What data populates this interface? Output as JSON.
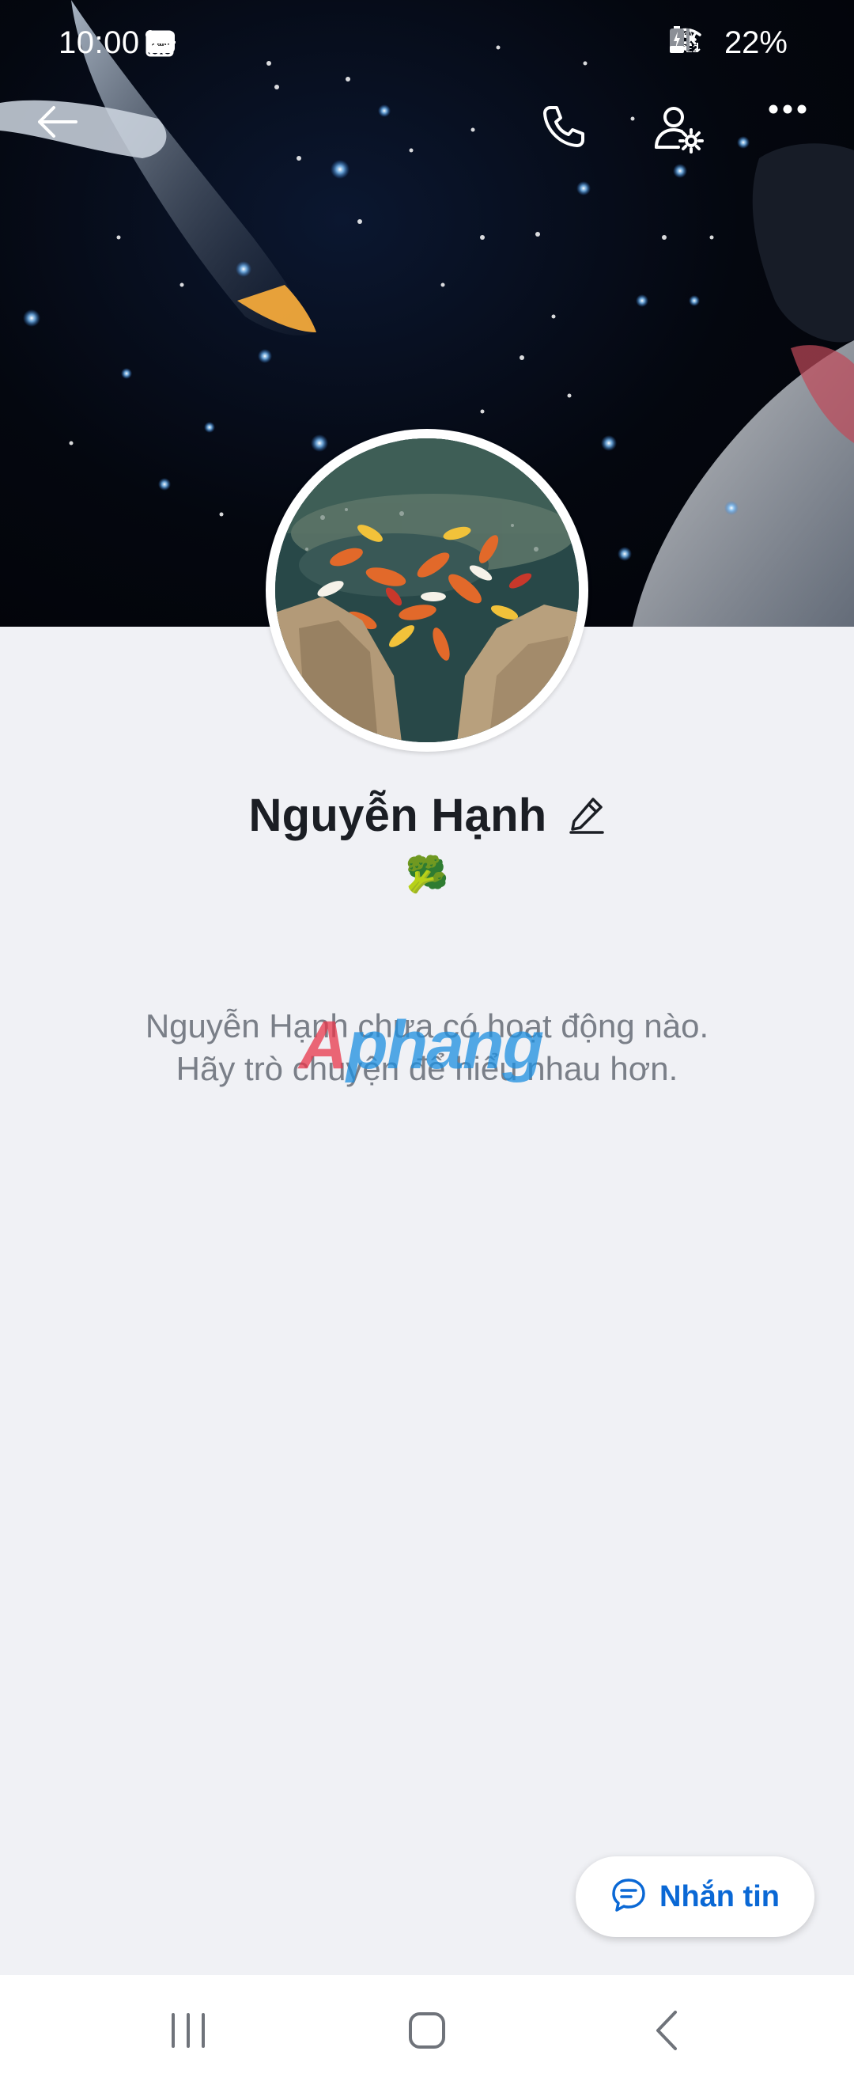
{
  "status_bar": {
    "time": "10:00",
    "battery": "22%",
    "notification_icons": [
      "zalo-icon",
      "incognito-icon",
      "gallery-icon",
      "dot-icon"
    ],
    "system_icons": [
      "mute-icon",
      "wifi-icon",
      "signal-icon",
      "volte-icon",
      "signal-icon",
      "battery-charging-icon"
    ],
    "zalo_badge_text": "Zalo",
    "volte_text": "Vo)) LTE2"
  },
  "app_bar": {
    "back_icon": "arrow-left-icon",
    "actions": [
      "phone-icon",
      "user-settings-icon",
      "more-icon"
    ]
  },
  "profile": {
    "name": "Nguyễn Hạnh",
    "status_emoji": "🥦",
    "edit_icon": "pencil-icon"
  },
  "empty_state": {
    "line1": "Nguyễn Hạnh chưa có hoạt động nào.",
    "line2": "Hãy trò chuyện để hiểu nhau hơn."
  },
  "watermark": {
    "part1": "A",
    "part2": "phang"
  },
  "message_button": {
    "label": "Nhắn tin",
    "icon": "chat-bubble-icon"
  },
  "nav_bar": {
    "items": [
      "recent-apps-icon",
      "home-icon",
      "back-icon"
    ]
  },
  "colors": {
    "accent": "#0a68d5",
    "background": "#f0f1f5",
    "text_primary": "#1b1e24",
    "text_secondary": "#7a7f88"
  }
}
